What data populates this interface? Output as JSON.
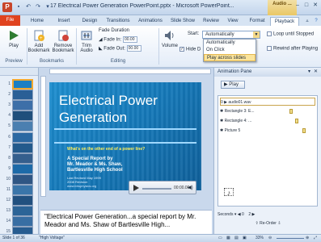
{
  "window": {
    "title": "17 Electrical Power Generation PowerPoint.pptx - Microsoft PowerPoint...",
    "context_group": "Audio ...",
    "app_letter": "P"
  },
  "tabs": [
    "File",
    "Home",
    "Insert",
    "Design",
    "Transitions",
    "Animations",
    "Slide Show",
    "Review",
    "View",
    "Format",
    "Playback"
  ],
  "active_tab": "Playback",
  "ribbon": {
    "preview": {
      "play_label": "Play",
      "group": "Preview"
    },
    "bookmarks": {
      "add_label": "Add Bookmark",
      "remove_label": "Remove Bookmark",
      "group": "Bookmarks"
    },
    "editing": {
      "trim_label": "Trim Audio",
      "fade_duration_label": "Fade Duration",
      "fade_in_label": "Fade In:",
      "fade_in_value": "00.00",
      "fade_out_label": "Fade Out:",
      "fade_out_value": "00.00",
      "group": "Editing"
    },
    "audio_options": {
      "volume_label": "Volume",
      "hide_label": "Hide D",
      "start_label": "Start:",
      "start_value": "Automatically",
      "start_options": [
        "Automatically",
        "On Click",
        "Play across slides"
      ],
      "start_selected": "Play across slides",
      "loop_label": "Loop until Stopped",
      "rewind_label": "Rewind after Playing"
    }
  },
  "slides": {
    "numbers": [
      "1",
      "2",
      "3",
      "4",
      "5",
      "6",
      "7",
      "8",
      "9",
      "10",
      "11",
      "12",
      "13",
      "14",
      "15"
    ],
    "active": "1"
  },
  "slide": {
    "title_line1": "Electrical Power",
    "title_line2": "Generation",
    "subtitle": "What's on the other end of a power line?",
    "body_line1": "A Special Report by",
    "body_line2": "Mr. Meador & Ms. Shaw,",
    "body_line3": "Bartlesville High School",
    "small_line1": "Last Revised May 1999",
    "small_line2": "2008 Revision",
    "link": "www.bhsphysics.org",
    "player_time": "00:00.00"
  },
  "notes": {
    "text": "\"Electrical Power Generation...a special report by Mr. Meador and Ms. Shaw of Bartlesville High..."
  },
  "animation_pane": {
    "title": "Animation Pane",
    "play_label": "Play",
    "items": [
      {
        "index": "0",
        "name": "audio01.wav"
      },
      {
        "index": "",
        "name": "Rectangle 3: E..."
      },
      {
        "index": "",
        "name": "Rectangle 4: ..."
      },
      {
        "index": "",
        "name": "Picture 5"
      }
    ],
    "seconds_label": "Seconds",
    "seconds_value": "0",
    "seconds_value2": "2",
    "reorder_label": "Re-Order"
  },
  "status": {
    "slide_info": "Slide 1 of 36",
    "theme": "\"High Voltage\"",
    "zoom": "33%"
  }
}
